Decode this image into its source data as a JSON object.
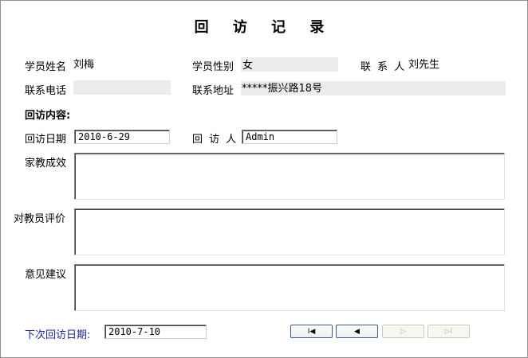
{
  "title": "回 访 记 录",
  "student": {
    "name_label": "学员姓名",
    "name_value": "刘梅",
    "gender_label": "学员性别",
    "gender_value": "女",
    "contact_label": "联 系 人",
    "contact_value": "刘先生",
    "phone_label": "联系电话",
    "phone_value": "",
    "address_label": "联系地址",
    "address_value": "*****振兴路18号"
  },
  "visit": {
    "section_label": "回访内容:",
    "date_label": "回访日期",
    "date_value": "2010-6-29",
    "visitor_label": "回 访 人",
    "visitor_value": "Admin",
    "effect_label": "家教成效",
    "teacher_eval_label": "对教员评价",
    "suggestion_label": "意见建议"
  },
  "next_visit": {
    "label": "下次回访日期:",
    "value": "2010-7-10"
  },
  "nav": {
    "first_icon": "first-record-icon",
    "prev_icon": "previous-record-icon",
    "next_icon": "next-record-icon",
    "last_icon": "last-record-icon",
    "first_glyph": "I◀",
    "prev_glyph": "◀",
    "next_glyph": "▷",
    "last_glyph": "▷I"
  }
}
